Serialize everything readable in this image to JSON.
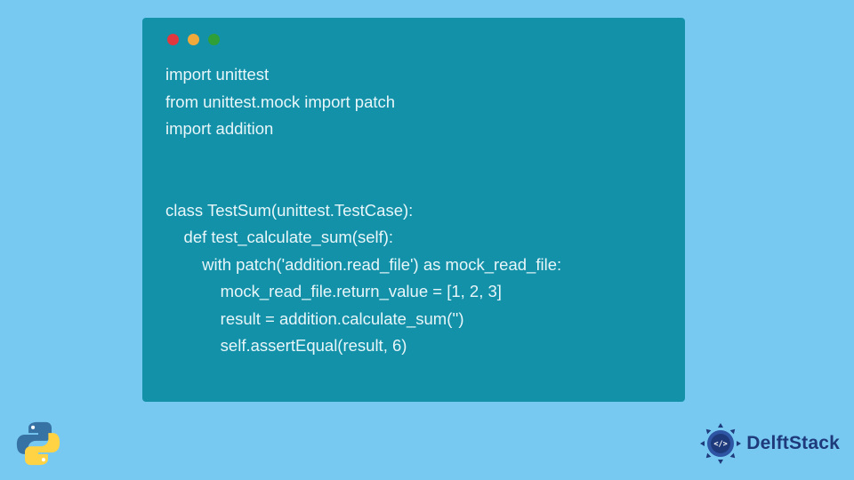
{
  "window": {
    "dots": [
      "red",
      "yellow",
      "green"
    ]
  },
  "code": {
    "line1": "import unittest",
    "line2": "from unittest.mock import patch",
    "line3": "import addition",
    "line4": "",
    "line5": "",
    "line6": "class TestSum(unittest.TestCase):",
    "line7": "    def test_calculate_sum(self):",
    "line8": "        with patch('addition.read_file') as mock_read_file:",
    "line9": "            mock_read_file.return_value = [1, 2, 3]",
    "line10": "            result = addition.calculate_sum('')",
    "line11": "            self.assertEqual(result, 6)"
  },
  "branding": {
    "name": "DelftStack"
  },
  "colors": {
    "bg": "#77C9F2",
    "window": "#1291A9",
    "text": "#E8F6F9",
    "brandBlue": "#1E3A7B"
  }
}
